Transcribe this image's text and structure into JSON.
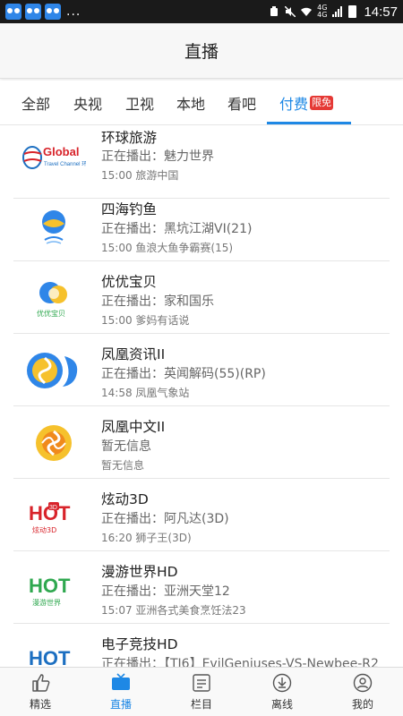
{
  "status_bar": {
    "network_top": "4G",
    "network_bottom": "4G",
    "time": "14:57",
    "more": "..."
  },
  "header": {
    "title": "直播"
  },
  "tabs": [
    {
      "label": "全部"
    },
    {
      "label": "央视"
    },
    {
      "label": "卫视"
    },
    {
      "label": "本地"
    },
    {
      "label": "看吧"
    },
    {
      "label": "付费",
      "badge": "限免",
      "active": true
    }
  ],
  "channels": [
    {
      "name": "环球旅游",
      "now_prefix": "正在播出：",
      "now": "魅力世界",
      "next": "15:00 旅游中国",
      "logo_text": "Global",
      "logo_sub": "Travel Channel 环球旅游"
    },
    {
      "name": "四海钓鱼",
      "now_prefix": "正在播出：",
      "now": "黑坑江湖VI(21)",
      "next": "15:00 鱼浪大鱼争霸赛(15)"
    },
    {
      "name": "优优宝贝",
      "now_prefix": "正在播出：",
      "now": "家和国乐",
      "next": "15:00 爹妈有话说",
      "logo_text": "优优宝贝"
    },
    {
      "name": "凤凰资讯II",
      "now_prefix": "正在播出：",
      "now": "英闻解码(55)(RP)",
      "next": "14:58 凤凰气象站"
    },
    {
      "name": "凤凰中文II",
      "now_prefix": "",
      "now": "暂无信息",
      "next": "暂无信息"
    },
    {
      "name": "炫动3D",
      "now_prefix": "正在播出：",
      "now": "阿凡达(3D)",
      "next": "16:20 狮子王(3D)",
      "logo_text": "HOT",
      "logo_sub": "炫动3D",
      "logo_badge": "3D"
    },
    {
      "name": "漫游世界HD",
      "now_prefix": "正在播出：",
      "now": "亚洲天堂12",
      "next": "15:07 亚洲各式美食烹饪法23",
      "logo_text": "HOT",
      "logo_sub": "漫游世界"
    },
    {
      "name": "电子竞技HD",
      "now_prefix": "正在播出：",
      "now": "【TI6】EvilGeniuses-VS-Newbee-R2",
      "next": "",
      "logo_text": "HOT"
    }
  ],
  "bottom_nav": [
    {
      "label": "精选",
      "icon": "thumbs-up-icon"
    },
    {
      "label": "直播",
      "icon": "tv-icon",
      "active": true
    },
    {
      "label": "栏目",
      "icon": "list-icon"
    },
    {
      "label": "离线",
      "icon": "download-icon"
    },
    {
      "label": "我的",
      "icon": "user-icon"
    }
  ],
  "colors": {
    "accent": "#1e88e5",
    "badge": "#e53935",
    "global_red": "#d8232a",
    "hot_red": "#d8232a",
    "hot_green": "#2fa84f",
    "hot_blue": "#1c6fc1",
    "phoenix_yellow": "#f6c12c"
  }
}
